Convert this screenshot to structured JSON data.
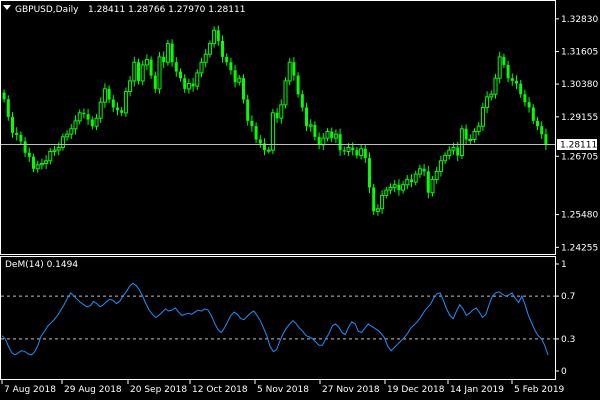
{
  "header": {
    "symbol": "GBPUSD,Daily",
    "ohlc": "1.28411 1.28766 1.27970 1.28111"
  },
  "indicator": {
    "label": "DeM(14) 0.1494"
  },
  "colors": {
    "background": "#000000",
    "candle": "#00ff00",
    "frame": "#ffffff",
    "oscillator": "#1e90ff",
    "level_line": "#c0c0c0",
    "current_price_line": "#c0c0c0"
  },
  "chart_data": [
    {
      "type": "candlestick",
      "symbol": "GBPUSD",
      "timeframe": "Daily",
      "current_price": 1.28111,
      "current_price_label": "1.28111",
      "y_ticks": [
        1.3283,
        1.316,
        1.3038,
        1.2915,
        1.2767,
        1.2548,
        1.2425
      ],
      "y_tick_labels": [
        "1.32830",
        "1.31605",
        "1.30380",
        "1.29155",
        "1.26705",
        "1.25480",
        "1.24255"
      ],
      "ylim": [
        1.24,
        1.335
      ],
      "x_tick_labels": [
        "7 Aug 2018",
        "29 Aug 2018",
        "20 Sep 2018",
        "12 Oct 2018",
        "5 Nov 2018",
        "27 Nov 2018",
        "19 Dec 2018",
        "14 Jan 2019",
        "5 Feb 2019"
      ],
      "close": [
        1.2981,
        1.2915,
        1.2855,
        1.2847,
        1.2823,
        1.278,
        1.2765,
        1.272,
        1.2735,
        1.274,
        1.275,
        1.2785,
        1.279,
        1.28,
        1.284,
        1.285,
        1.287,
        1.29,
        1.293,
        1.2925,
        1.2905,
        1.288,
        1.291,
        1.297,
        1.302,
        1.298,
        1.295,
        1.294,
        1.293,
        1.301,
        1.305,
        1.312,
        1.305,
        1.311,
        1.313,
        1.307,
        1.302,
        1.314,
        1.312,
        1.319,
        1.312,
        1.3085,
        1.306,
        1.302,
        1.304,
        1.303,
        1.308,
        1.312,
        1.315,
        1.319,
        1.324,
        1.32,
        1.314,
        1.312,
        1.309,
        1.3045,
        1.306,
        1.298,
        1.29,
        1.288,
        1.283,
        1.2815,
        1.279,
        1.279,
        1.293,
        1.291,
        1.296,
        1.305,
        1.312,
        1.307,
        1.3,
        1.295,
        1.288,
        1.2885,
        1.284,
        1.281,
        1.2835,
        1.286,
        1.2835,
        1.285,
        1.279,
        1.2785,
        1.28,
        1.279,
        1.277,
        1.2795,
        1.276,
        1.265,
        1.256,
        1.257,
        1.262,
        1.264,
        1.265,
        1.266,
        1.264,
        1.266,
        1.268,
        1.267,
        1.27,
        1.272,
        1.271,
        1.263,
        1.268,
        1.271,
        1.275,
        1.277,
        1.279,
        1.28,
        1.277,
        1.287,
        1.283,
        1.283,
        1.286,
        1.288,
        1.295,
        1.299,
        1.3,
        1.306,
        1.314,
        1.311,
        1.306,
        1.305,
        1.304,
        1.3,
        1.297,
        1.295,
        1.29,
        1.288,
        1.285,
        1.2811
      ],
      "oscillator": {
        "name": "DeM(14)",
        "value": 0.1494,
        "ylim": [
          0,
          1
        ],
        "y_tick_labels": [
          "1",
          "0.7",
          "0.3",
          "0"
        ],
        "levels": [
          0.7,
          0.3
        ],
        "values": [
          0.33,
          0.3,
          0.23,
          0.17,
          0.15,
          0.17,
          0.19,
          0.18,
          0.16,
          0.15,
          0.18,
          0.24,
          0.33,
          0.37,
          0.42,
          0.45,
          0.48,
          0.52,
          0.57,
          0.62,
          0.68,
          0.73,
          0.7,
          0.67,
          0.64,
          0.62,
          0.6,
          0.61,
          0.65,
          0.63,
          0.6,
          0.62,
          0.65,
          0.67,
          0.66,
          0.63,
          0.65,
          0.7,
          0.74,
          0.79,
          0.82,
          0.8,
          0.76,
          0.7,
          0.63,
          0.57,
          0.53,
          0.5,
          0.52,
          0.55,
          0.58,
          0.56,
          0.57,
          0.59,
          0.55,
          0.52,
          0.53,
          0.54,
          0.53,
          0.55,
          0.57,
          0.56,
          0.58,
          0.57,
          0.52,
          0.45,
          0.39,
          0.36,
          0.4,
          0.46,
          0.52,
          0.55,
          0.53,
          0.49,
          0.48,
          0.51,
          0.54,
          0.56,
          0.52,
          0.47,
          0.4,
          0.33,
          0.23,
          0.18,
          0.2,
          0.28,
          0.35,
          0.4,
          0.44,
          0.47,
          0.44,
          0.4,
          0.37,
          0.33,
          0.32,
          0.3,
          0.27,
          0.24,
          0.24,
          0.3,
          0.35,
          0.42,
          0.44,
          0.41,
          0.36,
          0.34,
          0.41,
          0.46,
          0.44,
          0.37,
          0.36,
          0.4,
          0.44,
          0.42,
          0.4,
          0.38,
          0.35,
          0.31,
          0.23,
          0.19,
          0.22,
          0.25,
          0.28,
          0.31,
          0.35,
          0.4,
          0.43,
          0.46,
          0.5,
          0.55,
          0.59,
          0.62,
          0.68,
          0.72,
          0.73,
          0.66,
          0.58,
          0.52,
          0.49,
          0.56,
          0.62,
          0.58,
          0.52,
          0.54,
          0.57,
          0.59,
          0.55,
          0.5,
          0.53,
          0.62,
          0.7,
          0.73,
          0.74,
          0.72,
          0.7,
          0.71,
          0.73,
          0.68,
          0.64,
          0.7,
          0.62,
          0.52,
          0.45,
          0.38,
          0.33,
          0.3,
          0.24,
          0.15
        ]
      }
    }
  ]
}
